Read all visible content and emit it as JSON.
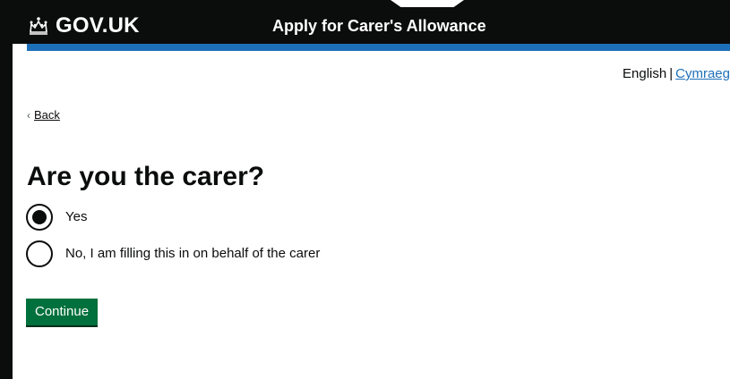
{
  "header": {
    "logo_text": "GOV.UK",
    "logo_icon": "crown-icon",
    "service_name": "Apply for Carer's Allowance"
  },
  "language": {
    "current": "English",
    "separator": "|",
    "alternate": "Cymraeg"
  },
  "back": {
    "icon": "chevron-left-icon",
    "label": "Back"
  },
  "question": {
    "title": "Are you the carer?",
    "options": [
      {
        "label": "Yes",
        "selected": true
      },
      {
        "label": "No, I am filling this in on behalf of the carer",
        "selected": false
      }
    ]
  },
  "actions": {
    "continue_label": "Continue"
  },
  "colors": {
    "header_bg": "#0b0c0c",
    "accent_blue": "#1d70b8",
    "button_green": "#00703c",
    "text": "#0b0c0c"
  }
}
